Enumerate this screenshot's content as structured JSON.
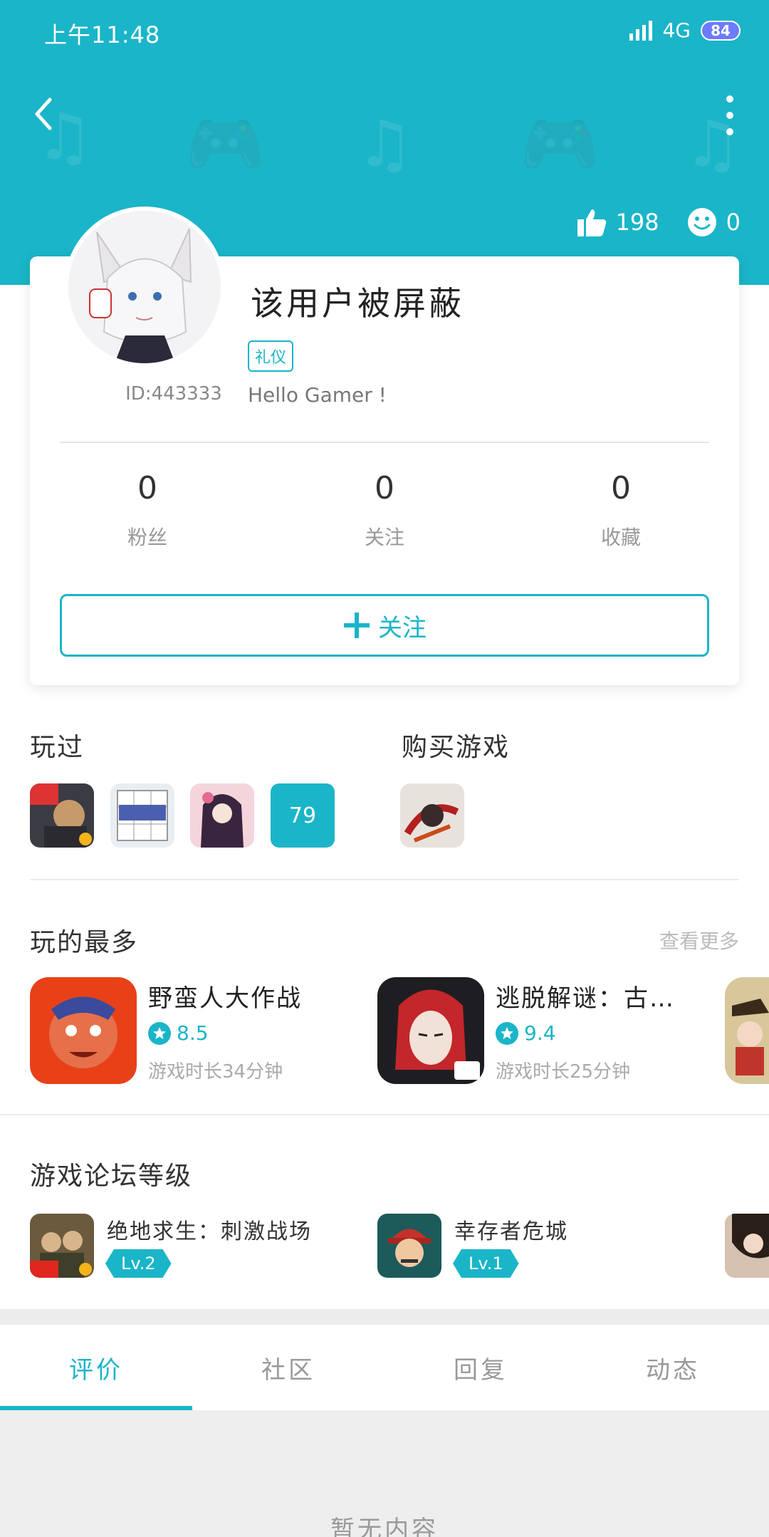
{
  "status_bar": {
    "time": "上午11:48",
    "network": "4G",
    "battery": "84"
  },
  "header": {
    "likes": "198",
    "smiles": "0"
  },
  "profile": {
    "username": "该用户被屏蔽",
    "tag": "礼仪",
    "bio": "Hello Gamer !",
    "user_id": "ID:443333",
    "stats": [
      {
        "value": "0",
        "label": "粉丝"
      },
      {
        "value": "0",
        "label": "关注"
      },
      {
        "value": "0",
        "label": "收藏"
      }
    ],
    "follow_label": "关注"
  },
  "played": {
    "title": "玩过",
    "more_count": "79"
  },
  "purchased": {
    "title": "购买游戏"
  },
  "most_played": {
    "title": "玩的最多",
    "view_more": "查看更多",
    "items": [
      {
        "name": "野蛮人大作战",
        "rating": "8.5",
        "time": "游戏时长34分钟"
      },
      {
        "name": "逃脱解谜：古…",
        "rating": "9.4",
        "time": "游戏时长25分钟"
      }
    ]
  },
  "forum_level": {
    "title": "游戏论坛等级",
    "items": [
      {
        "name": "绝地求生：刺激战场",
        "level": "Lv.2"
      },
      {
        "name": "幸存者危城",
        "level": "Lv.1"
      }
    ]
  },
  "tabs": [
    "评价",
    "社区",
    "回复",
    "动态"
  ],
  "empty_text": "暂无内容",
  "colors": {
    "accent": "#1ab5c8"
  }
}
